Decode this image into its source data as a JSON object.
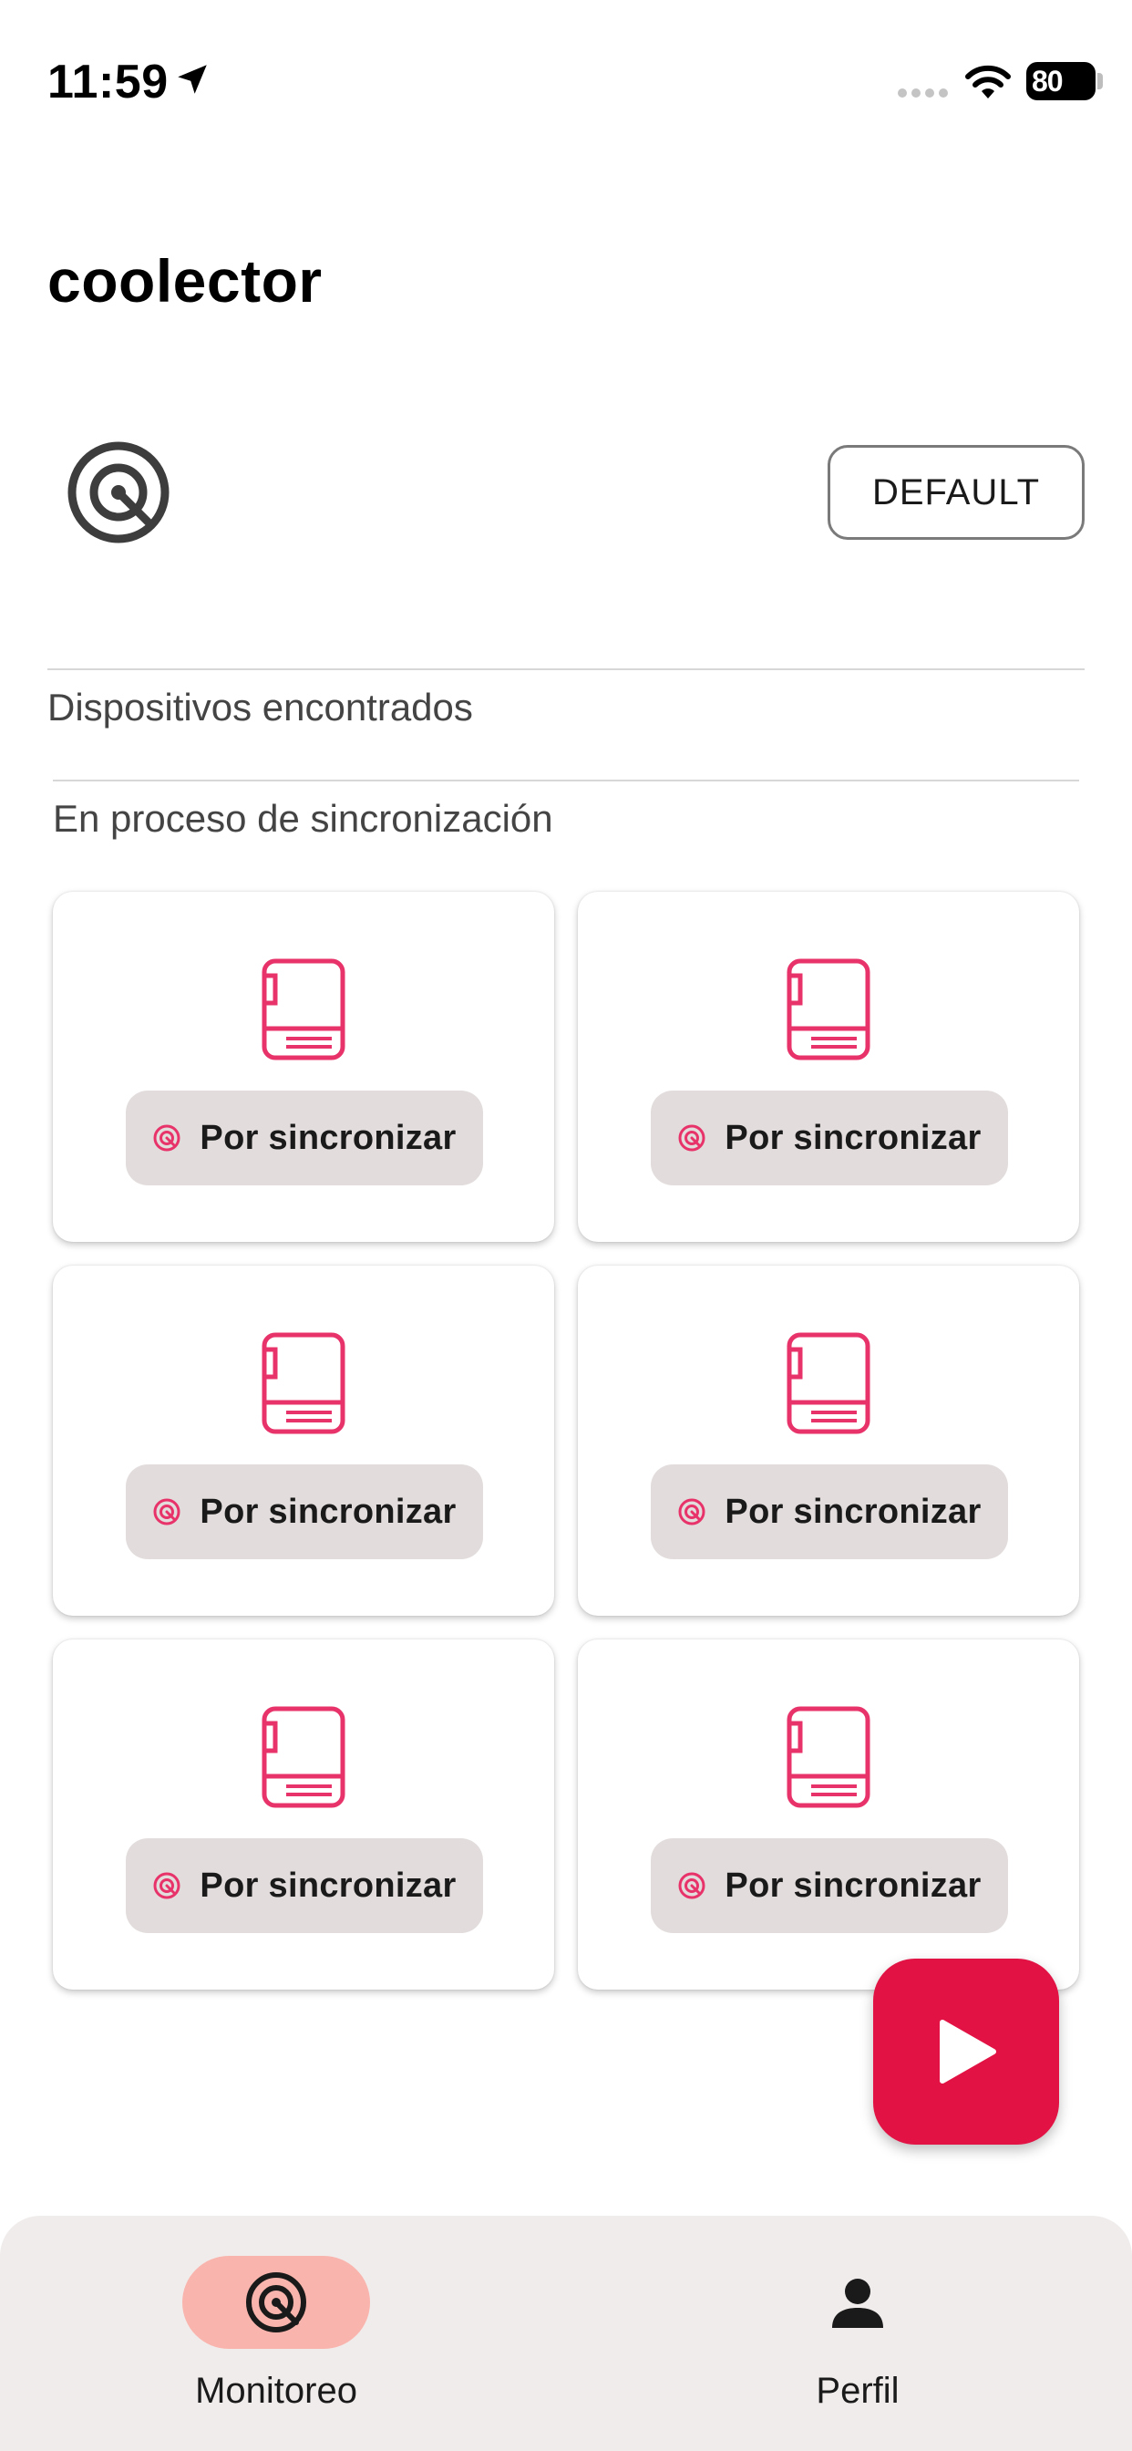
{
  "status_bar": {
    "time": "11:59",
    "battery": "80"
  },
  "app": {
    "title": "coolector"
  },
  "header": {
    "profile_button_label": "DEFAULT"
  },
  "sections": {
    "found_devices": "Dispositivos encontrados",
    "syncing": "En proceso de sincronización"
  },
  "devices": [
    {
      "status": "Por sincronizar"
    },
    {
      "status": "Por sincronizar"
    },
    {
      "status": "Por sincronizar"
    },
    {
      "status": "Por sincronizar"
    },
    {
      "status": "Por sincronizar"
    },
    {
      "status": "Por sincronizar"
    }
  ],
  "bottom_nav": {
    "items": [
      {
        "label": "Monitoreo",
        "icon": "target-icon",
        "active": true
      },
      {
        "label": "Perfil",
        "icon": "person-icon",
        "active": false
      }
    ]
  },
  "colors": {
    "accent": "#e21344",
    "accent_icon": "#e8336a",
    "active_nav_pill": "#f9b5ad",
    "chip_bg": "#e2dddc",
    "nav_bg": "#f1ecec"
  }
}
